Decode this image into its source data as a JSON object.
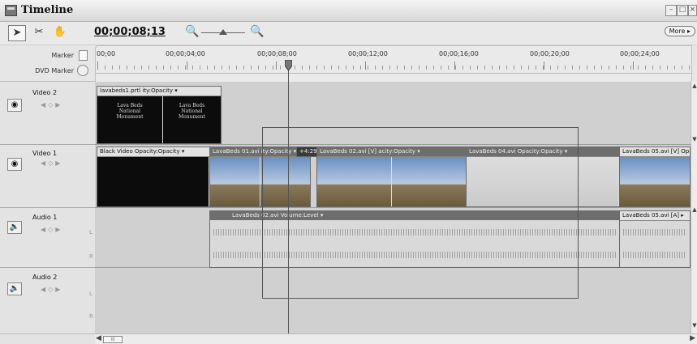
{
  "window": {
    "title": "Timeline"
  },
  "toolbar": {
    "timecode": "00;00;08;13",
    "more_label": "More ▸",
    "tools": [
      "selection-tool",
      "razor-tool",
      "hand-tool"
    ]
  },
  "ruler": {
    "marker_label": "Marker",
    "dvd_marker_label": "DVD Marker",
    "times": [
      "00;00",
      "00;00;04;00",
      "00;00;08;00",
      "00;00;12;00",
      "00;00;16;00",
      "00;00;20;00",
      "00;00;24;00"
    ]
  },
  "tracks": {
    "video2": {
      "name": "Video 2",
      "clip_label": "lavabeds1.prtl  ity:Opacity ▾",
      "title_text": "Lava Beds\nNational\nMonument"
    },
    "video1": {
      "name": "Video 1",
      "clips": [
        "Black Video  Opacity:Opacity ▾",
        "LavaBeds 01.avi  ity:Opacity ▾",
        "+4:29",
        "LavaBeds 02.avi  [V]  acity:Opacity ▾",
        "LavaBeds 04.avi  Opacity:Opacity ▾",
        "LavaBeds 05.avi  [V]  Opacity"
      ]
    },
    "audio1": {
      "name": "Audio 1",
      "clip_label": "LavaBeds 02.avi  Volume:Level ▾",
      "clip2_label": "LavaBeds 05.avi  [A]  ▸",
      "chan_l": "L",
      "chan_r": "R"
    },
    "audio2": {
      "name": "Audio 2",
      "chan_l": "L",
      "chan_r": "R"
    }
  },
  "scroll": {
    "thumb_label": "III"
  }
}
